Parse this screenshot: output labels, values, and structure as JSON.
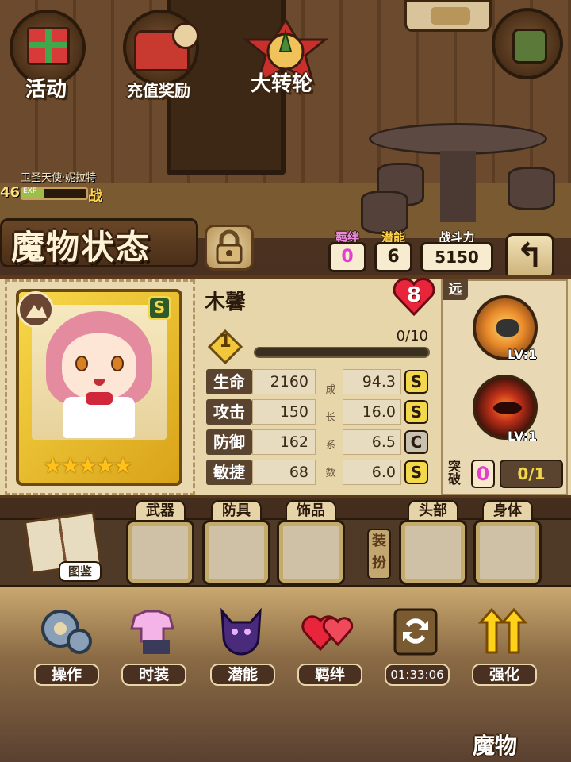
{
  "top_menu": [
    {
      "label": "活动",
      "icon": "gift-icon"
    },
    {
      "label": "充值奖励",
      "icon": "treasure-chest-icon"
    },
    {
      "label": "大转轮",
      "icon": "wheel-icon"
    }
  ],
  "mini_character": {
    "name": "卫圣天使·妮拉特",
    "level": "46",
    "exp_label": "EXP",
    "suffix": "战"
  },
  "header": {
    "title": "魔物状态",
    "bond_label": "羁绊",
    "bond_value": "0",
    "potential_label": "潜能",
    "potential_value": "6",
    "power_label": "战斗力",
    "power_value": "5150",
    "back_icon": "back-arrow-icon"
  },
  "monster": {
    "name": "木馨",
    "heart_value": "8",
    "rank_badge": "S",
    "star_count": 5,
    "stars": "★★★★★",
    "level": "1",
    "exp_text": "0/10",
    "exp_fraction": 0.0
  },
  "stats": [
    {
      "label": "生命",
      "value": "2160",
      "growth": "94.3",
      "grade": "S"
    },
    {
      "label": "攻击",
      "value": "150",
      "growth": "16.0",
      "grade": "S"
    },
    {
      "label": "防御",
      "value": "162",
      "growth": "6.5",
      "grade": "C"
    },
    {
      "label": "敏捷",
      "value": "68",
      "growth": "6.0",
      "grade": "S"
    }
  ],
  "growth_vertical": [
    "成",
    "长",
    "系",
    "数"
  ],
  "side": {
    "range_tag": "远",
    "skills": [
      {
        "level": "LV:1"
      },
      {
        "level": "LV:1"
      }
    ],
    "break_label": "突破",
    "break_value": "0",
    "break_fraction": "0/1"
  },
  "equipment": {
    "left_group": [
      "武器",
      "防具",
      "饰品"
    ],
    "right_group": [
      "头部",
      "身体"
    ],
    "vertical_label": "装扮",
    "book_label": "图鉴"
  },
  "actions": [
    {
      "label": "操作",
      "icon": "gears-icon"
    },
    {
      "label": "时装",
      "icon": "clothes-icon"
    },
    {
      "label": "潜能",
      "icon": "demon-silhouette-icon"
    },
    {
      "label": "羁绊",
      "icon": "hearts-icon"
    },
    {
      "label": "01:33:06",
      "icon": "refresh-swap-icon"
    },
    {
      "label": "强化",
      "icon": "upgrade-arrows-icon"
    }
  ],
  "bottom_right_label": "魔物"
}
